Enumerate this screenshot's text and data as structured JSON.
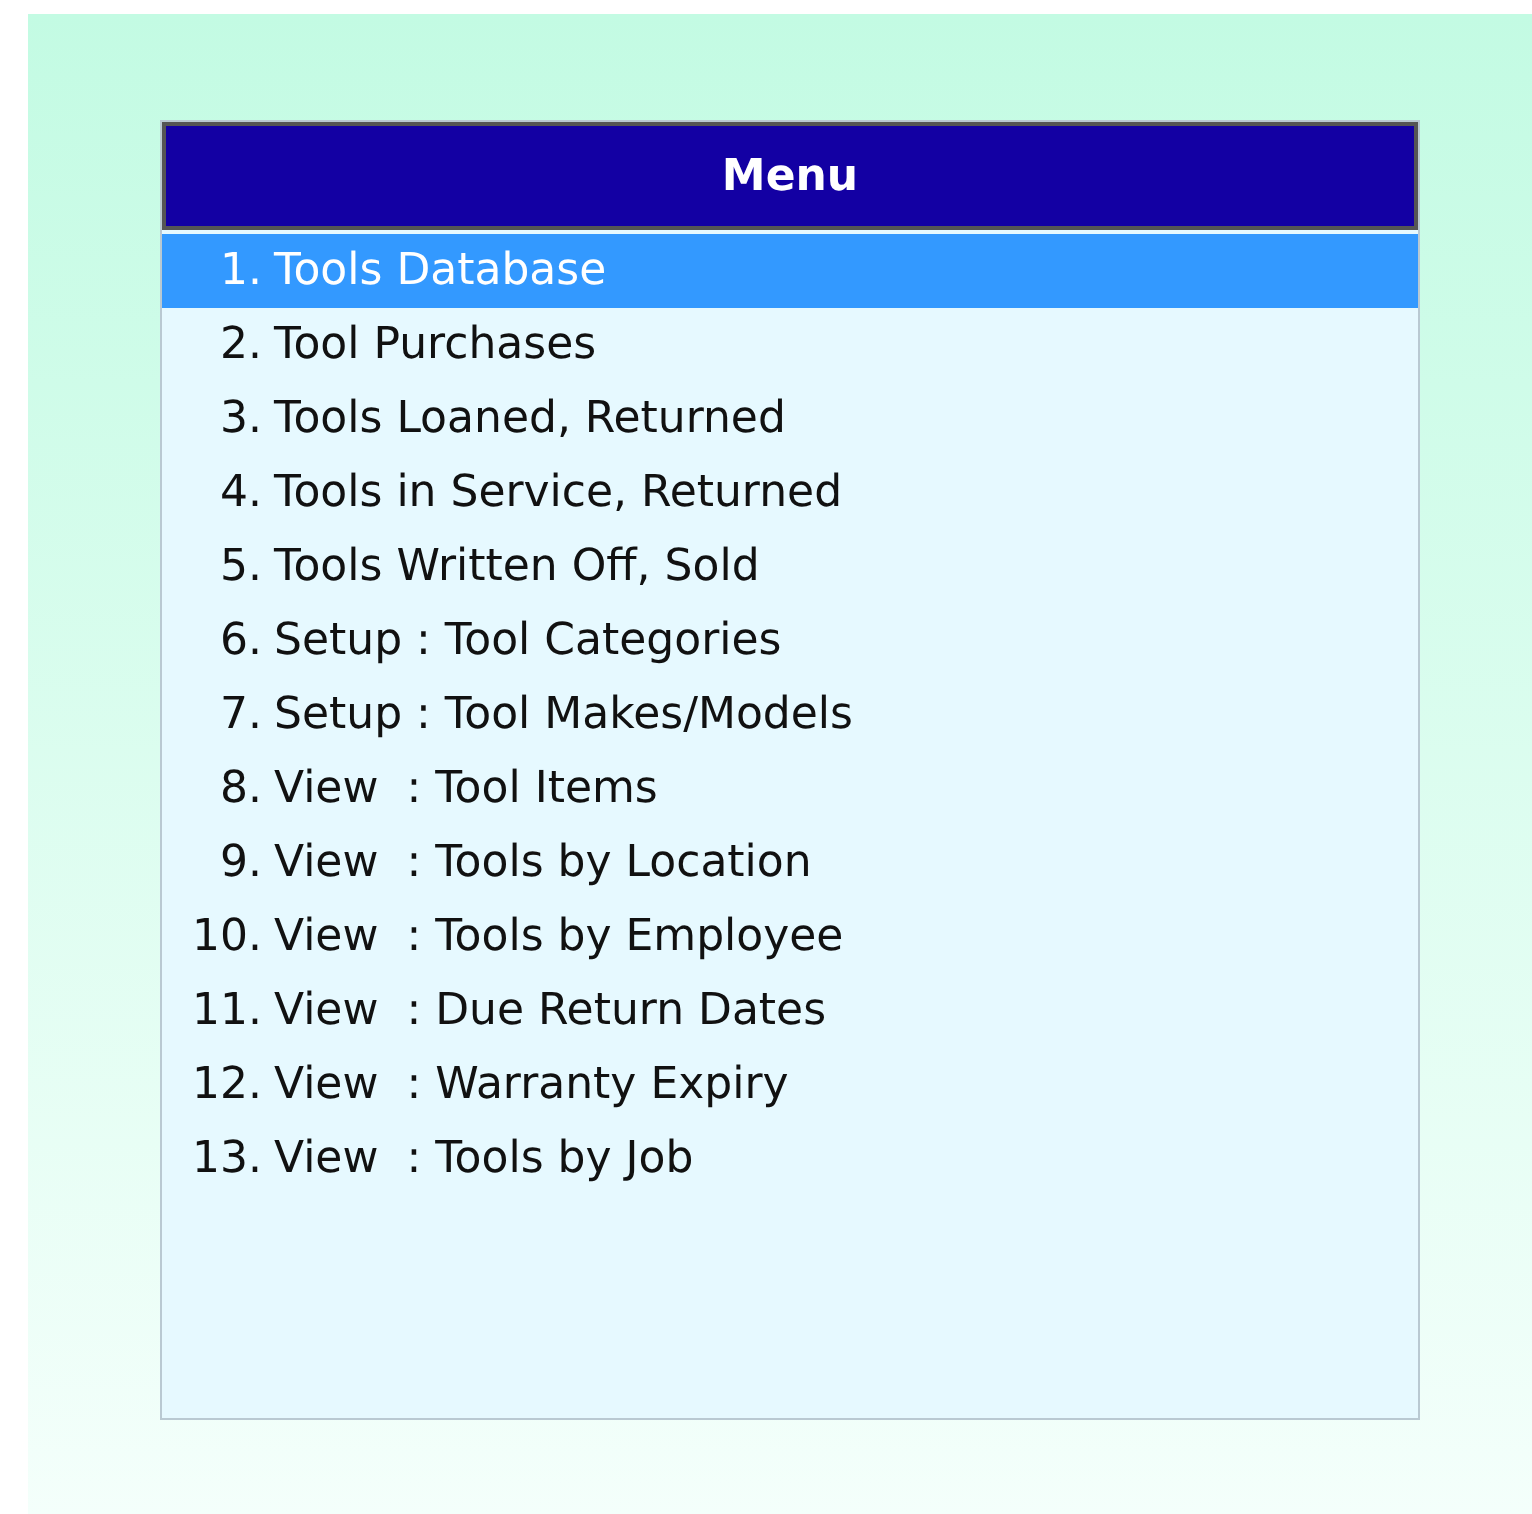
{
  "menu": {
    "title": "Menu",
    "items": [
      {
        "number": "1.",
        "label": "Tools Database",
        "selected": true
      },
      {
        "number": "2.",
        "label": "Tool Purchases",
        "selected": false
      },
      {
        "number": "3.",
        "label": "Tools Loaned, Returned",
        "selected": false
      },
      {
        "number": "4.",
        "label": "Tools in Service, Returned",
        "selected": false
      },
      {
        "number": "5.",
        "label": "Tools Written Off, Sold",
        "selected": false
      },
      {
        "number": "6.",
        "label": "Setup : Tool Categories",
        "selected": false
      },
      {
        "number": "7.",
        "label": "Setup : Tool Makes/Models",
        "selected": false
      },
      {
        "number": "8.",
        "label": "View  : Tool Items",
        "selected": false
      },
      {
        "number": "9.",
        "label": "View  : Tools by Location",
        "selected": false
      },
      {
        "number": "10.",
        "label": "View  : Tools by Employee",
        "selected": false
      },
      {
        "number": "11.",
        "label": "View  : Due Return Dates",
        "selected": false
      },
      {
        "number": "12.",
        "label": "View  : Warranty Expiry",
        "selected": false
      },
      {
        "number": "13.",
        "label": "View  : Tools by Job",
        "selected": false
      }
    ]
  }
}
